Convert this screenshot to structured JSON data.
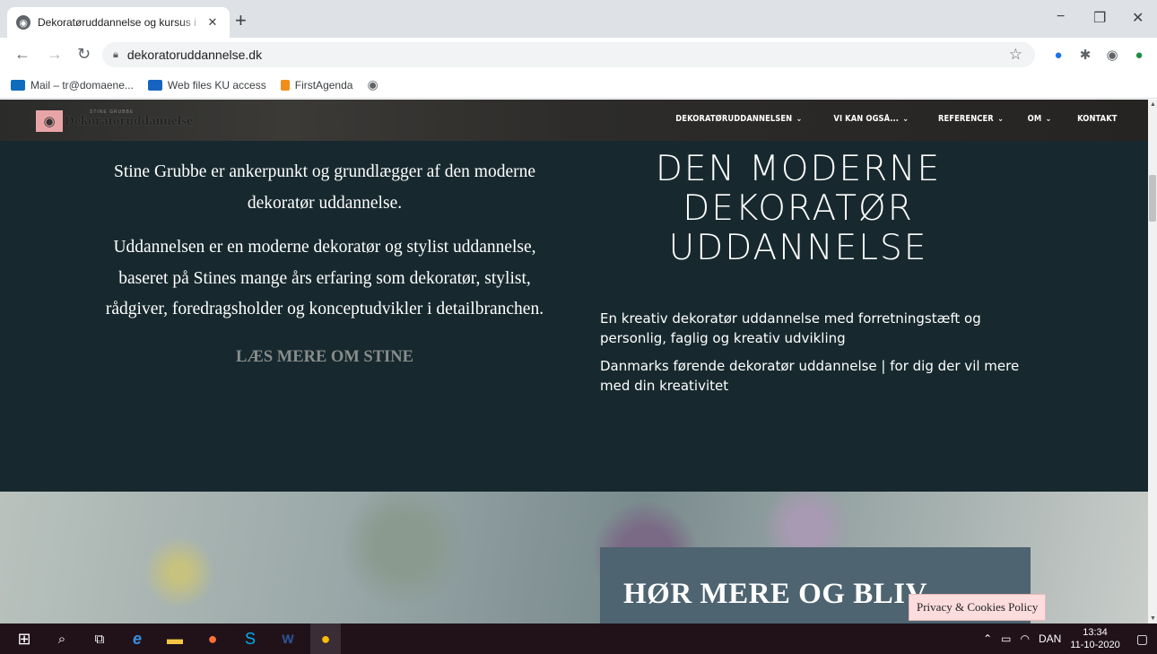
{
  "browser": {
    "tab_title": "Dekoratøruddannelse og kursus i ",
    "new_tab": "+",
    "url": "dekoratoruddannelse.dk",
    "bookmarks": [
      {
        "label": "Mail – tr@domaene...",
        "color": "#0f6cbd"
      },
      {
        "label": "Web files KU access",
        "color": "#1565c0"
      },
      {
        "label": "FirstAgenda",
        "color": "#f28c1c"
      }
    ]
  },
  "site": {
    "logo_text": "Dekoratøruddannelse",
    "logo_small": "STINE GRUBBE",
    "nav": [
      {
        "label": "DEKORATØRUDDANNELSEN",
        "caret": "⌄"
      },
      {
        "label": "VI KAN OGSÅ...",
        "caret": "⌄"
      },
      {
        "label": "REFERENCER",
        "caret": "⌄"
      },
      {
        "label": "OM",
        "caret": "⌄"
      },
      {
        "label": "KONTAKT",
        "caret": ""
      }
    ],
    "left": {
      "p1": "Stine Grubbe er ankerpunkt og grundlægger af den moderne  dekoratør uddannelse.",
      "p2": "Uddannelsen er en moderne dekoratør og stylist uddannelse, baseret på Stines mange års erfaring som dekoratør, stylist, rådgiver, foredragsholder og konceptudvikler i detailbranchen.",
      "read_more": "LÆS MERE OM STINE"
    },
    "right": {
      "title_lines": [
        "DEN MODERNE",
        "DEKORATØR",
        "UDDANNELSE"
      ],
      "p1": "En kreativ dekoratør uddannelse med forretningstæft og personlig, faglig og kreativ udvikling",
      "p2": "Danmarks førende dekoratør uddannelse |  for dig der vil mere med din kreativitet"
    },
    "cta_title": "HØR MERE OG BLIV",
    "privacy": "Privacy & Cookies Policy"
  },
  "taskbar": {
    "language": "DAN",
    "time": "13:34",
    "date": "11-10-2020"
  }
}
